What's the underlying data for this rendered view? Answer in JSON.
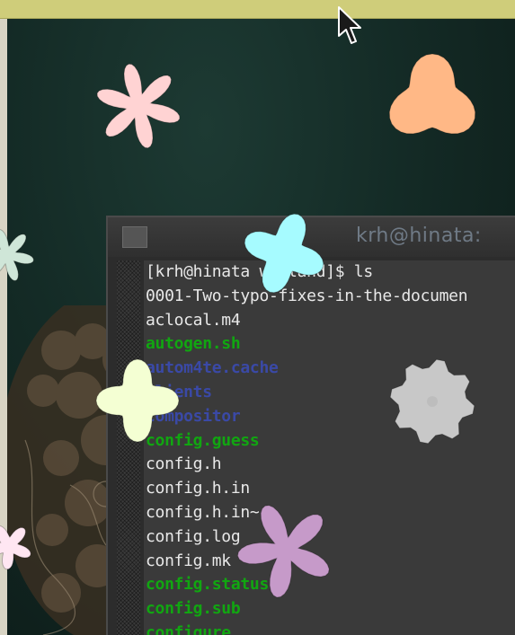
{
  "terminal": {
    "title": "krh@hinata:",
    "lines": [
      {
        "text": "[krh@hinata wayland]$ ls",
        "style": "normal"
      },
      {
        "text": "0001-Two-typo-fixes-in-the-documen",
        "style": "normal"
      },
      {
        "text": "aclocal.m4",
        "style": "normal"
      },
      {
        "text": "autogen.sh",
        "style": "green"
      },
      {
        "text": "autom4te.cache",
        "style": "blue"
      },
      {
        "text": "clients",
        "style": "blue"
      },
      {
        "text": "compositor",
        "style": "blue"
      },
      {
        "text": "config.guess",
        "style": "green"
      },
      {
        "text": "config.h",
        "style": "normal"
      },
      {
        "text": "config.h.in",
        "style": "normal"
      },
      {
        "text": "config.h.in~",
        "style": "normal"
      },
      {
        "text": "config.log",
        "style": "normal"
      },
      {
        "text": "config.mk",
        "style": "normal"
      },
      {
        "text": "config.status",
        "style": "green"
      },
      {
        "text": "config.sub",
        "style": "green"
      },
      {
        "text": "configure",
        "style": "green"
      }
    ]
  },
  "icons": {
    "cursor": "arrow-pointer-icon",
    "window_menu": "window-menu-icon"
  },
  "colors": {
    "top_bar": "#cfcd7a",
    "terminal_bg": "#3a3a3a",
    "text": "#e8e8e8",
    "executable": "#11a611",
    "directory": "#3a49a6",
    "flower_pink": "#ffd3d3",
    "flower_orange": "#ffb886",
    "flower_cyan": "#a6fbff",
    "flower_yellow": "#f4ffd3",
    "flower_gray": "#c8c8c8",
    "flower_purple": "#c69ac9"
  }
}
